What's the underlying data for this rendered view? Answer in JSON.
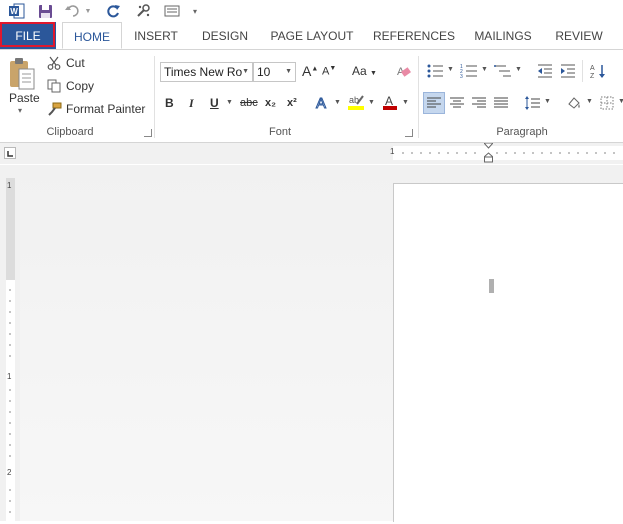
{
  "tabs": {
    "file": "FILE",
    "home": "HOME",
    "insert": "INSERT",
    "design": "DESIGN",
    "page_layout": "PAGE LAYOUT",
    "references": "REFERENCES",
    "mailings": "MAILINGS",
    "review": "REVIEW"
  },
  "clipboard": {
    "paste": "Paste",
    "cut": "Cut",
    "copy": "Copy",
    "format_painter": "Format Painter",
    "label": "Clipboard"
  },
  "font": {
    "name": "Times New Ro",
    "size": "10",
    "label": "Font",
    "bold": "B",
    "italic": "I",
    "underline": "U",
    "strike": "abc",
    "subscript": "x₂",
    "superscript": "x²",
    "grow": "A",
    "shrink": "A",
    "change_case": "Aa",
    "highlight_color": "#ffff00",
    "font_color": "#c00000"
  },
  "paragraph": {
    "label": "Paragraph"
  },
  "ruler": {
    "h1": "1",
    "v1": "1",
    "v2": "1",
    "v3": "2"
  },
  "colors": {
    "file_tab": "#2b579a",
    "file_outline": "#e0182d",
    "accent": "#2b579a"
  }
}
